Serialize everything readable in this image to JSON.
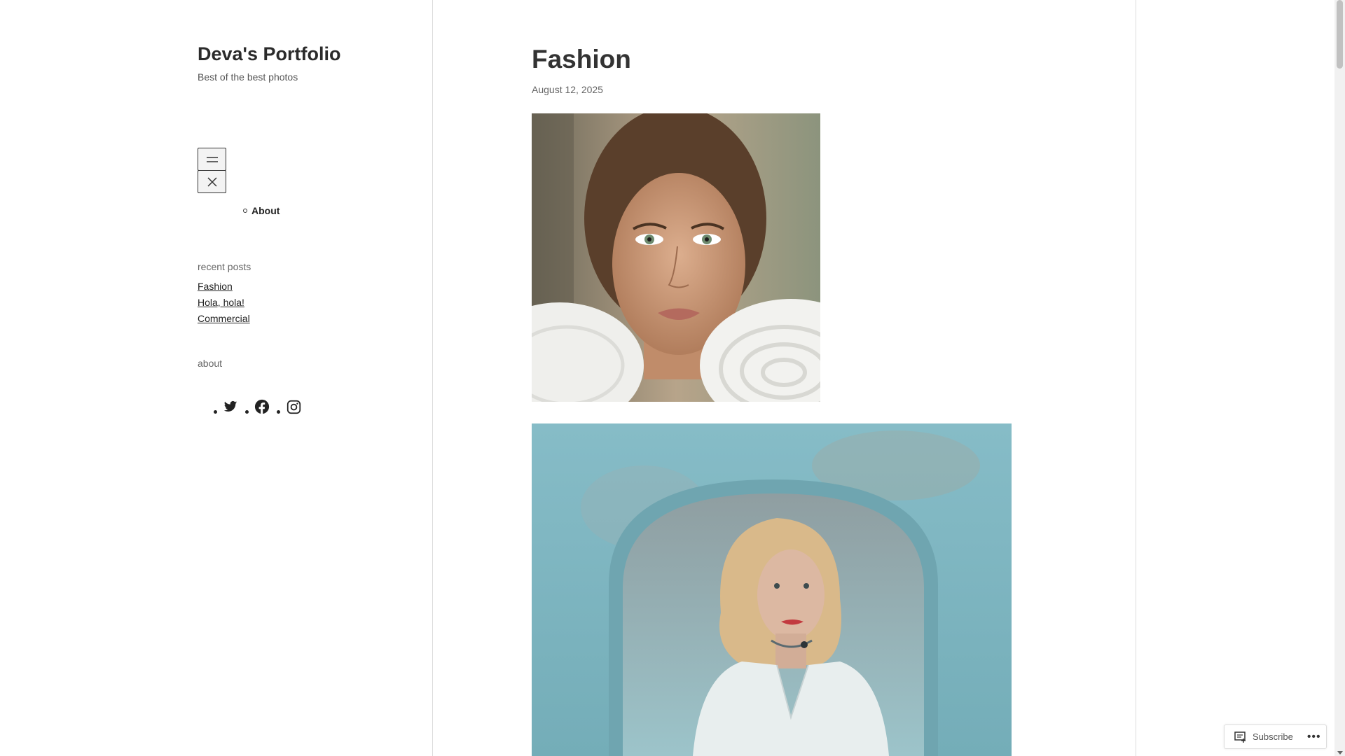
{
  "site": {
    "title": "Deva's Portfolio",
    "tagline": "Best of the best photos"
  },
  "nav": {
    "open_icon": "hamburger-menu-icon",
    "close_icon": "close-icon",
    "items": [
      {
        "label": "About"
      }
    ]
  },
  "widgets": {
    "recent_title": "recent posts",
    "recent_posts": [
      {
        "label": "Fashion"
      },
      {
        "label": "Hola, hola!"
      },
      {
        "label": "Commercial"
      }
    ],
    "about_title": "about",
    "social_icons": [
      "twitter-icon",
      "facebook-icon",
      "instagram-icon"
    ]
  },
  "post": {
    "title": "Fashion",
    "date": "August 12, 2025"
  },
  "subscribe": {
    "label": "Subscribe",
    "more": "•••"
  },
  "colors": {
    "text": "#222222",
    "rule": "#dcdcdc",
    "photo2_bg": "#7fb3be"
  }
}
